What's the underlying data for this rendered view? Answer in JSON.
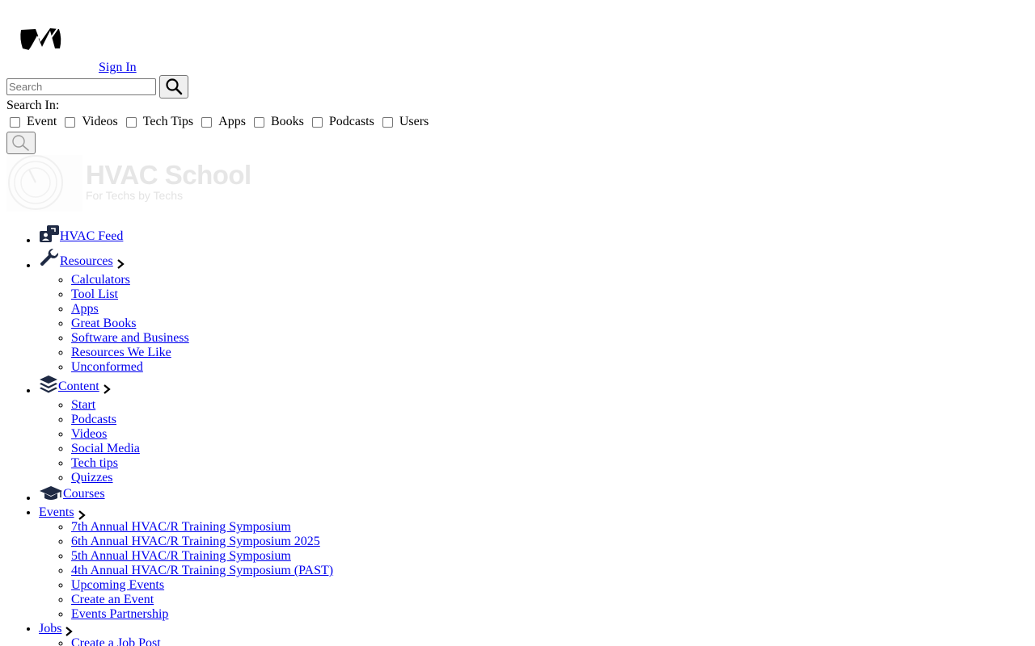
{
  "header": {
    "signin_label": "Sign In"
  },
  "search": {
    "placeholder": "Search",
    "search_in_label": "Search In:",
    "filters": [
      "Event",
      "Videos",
      "Tech Tips",
      "Apps",
      "Books",
      "Podcasts",
      "Users"
    ]
  },
  "brand": {
    "title": "HVAC School",
    "tagline": "For Techs by Techs"
  },
  "nav": {
    "feed": {
      "label": "HVAC Feed",
      "icon": "chat-users-icon"
    },
    "resources": {
      "label": "Resources",
      "icon": "wrench-icon",
      "items": [
        "Calculators",
        "Tool List",
        "Apps",
        "Great Books",
        "Software and Business",
        "Resources We Like",
        "Unconformed"
      ]
    },
    "content": {
      "label": "Content",
      "icon": "layers-icon",
      "items": [
        "Start",
        "Podcasts",
        "Videos",
        "Social Media",
        "Tech tips",
        "Quizzes"
      ]
    },
    "courses": {
      "label": "Courses",
      "icon": "graduation-cap-icon"
    },
    "events": {
      "label": "Events",
      "items": [
        "7th Annual HVAC/R Training Symposium",
        "6th Annual HVAC/R Training Symposium 2025",
        "5th Annual HVAC/R Training Symposium",
        "4th Annual HVAC/R Training Symposium (PAST)",
        "Upcoming Events",
        "Create an Event",
        "Events Partnership"
      ]
    },
    "jobs": {
      "label": "Jobs",
      "items": [
        "Create a Job Post"
      ]
    }
  },
  "colors": {
    "link": "#0000ee",
    "brand_logo": "#e6e6e6"
  }
}
